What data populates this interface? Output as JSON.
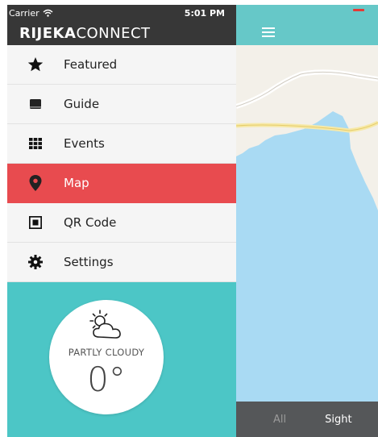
{
  "status_bar": {
    "carrier": "Carrier",
    "time": "5:01 PM"
  },
  "header": {
    "brand_bold": "RIJEKA",
    "brand_light": "CONNECT"
  },
  "menu": {
    "items": [
      {
        "label": "Featured",
        "icon": "star-icon",
        "active": false
      },
      {
        "label": "Guide",
        "icon": "book-icon",
        "active": false
      },
      {
        "label": "Events",
        "icon": "calendar-grid-icon",
        "active": false
      },
      {
        "label": "Map",
        "icon": "map-pin-icon",
        "active": true
      },
      {
        "label": "QR Code",
        "icon": "qr-code-icon",
        "active": false
      },
      {
        "label": "Settings",
        "icon": "gear-icon",
        "active": false
      }
    ]
  },
  "weather": {
    "condition": "PARTLY CLOUDY",
    "temperature": "0°",
    "icon": "partly-cloudy-icon"
  },
  "map": {
    "filter_tabs": [
      {
        "label": "All"
      },
      {
        "label": "Sight"
      }
    ]
  },
  "colors": {
    "dark_bar": "#373737",
    "active_item": "#e84b4f",
    "teal": "#4cc6c6",
    "map_water": "#a9daf3",
    "map_land": "#f3f0e9",
    "bottom_bar": "#555759"
  }
}
